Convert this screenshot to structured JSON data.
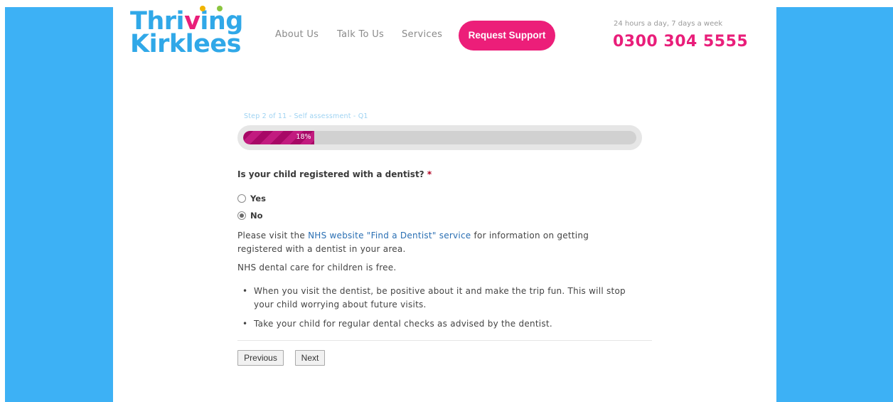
{
  "header": {
    "logo": {
      "line1_pre": "Thri",
      "line1_heart": "v",
      "line1_post": "ing",
      "line2": "Kirklees"
    },
    "nav": {
      "about": "About Us",
      "talk": "Talk To Us",
      "services": "Services"
    },
    "request_button": "Request Support",
    "hours": "24 hours a day, 7 days a week",
    "phone": "0300 304 5555"
  },
  "form": {
    "step_label": "Step 2 of 11 - Self assessment - Q1",
    "progress": {
      "percent": 18,
      "label": "18%"
    },
    "question": "Is your child registered with a dentist?",
    "required_mark": "*",
    "options": [
      {
        "label": "Yes",
        "selected": false
      },
      {
        "label": "No",
        "selected": true
      }
    ],
    "info": {
      "visit_pre": "Please visit the ",
      "link": "NHS website \"Find a Dentist\" service",
      "visit_post": " for information on getting registered with a dentist in your area.",
      "free": "NHS dental care for children is free.",
      "bullets": [
        "When you visit the dentist, be positive about it and make the trip fun. This will stop your child worrying about future visits.",
        "Take your child for regular dental checks as advised by the dentist."
      ]
    },
    "previous_button": "Previous",
    "next_button": "Next"
  },
  "colors": {
    "side_panels": "#3db1f5",
    "brand_pink": "#e91e7a",
    "logo_blue": "#30a8e8",
    "progress_fill": "#a70866"
  }
}
